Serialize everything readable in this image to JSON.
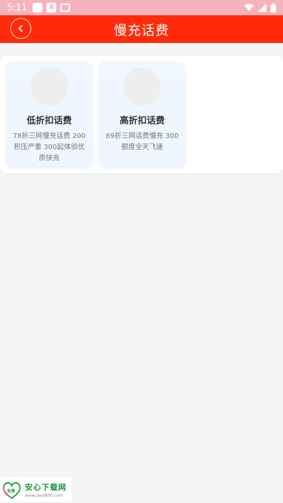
{
  "status_bar": {
    "time": "5:11",
    "icons": [
      "notification-box-icon",
      "font-a-icon",
      "image-icon",
      "wifi-icon",
      "signal-icon",
      "battery-icon"
    ]
  },
  "header": {
    "title": "慢充话费",
    "back_icon": "chevron-left-icon",
    "background_color": "#ff2b0a"
  },
  "products": [
    {
      "name": "低折扣话费",
      "description": "78折三网慢充话费 200积压严重 300起体验优质快充"
    },
    {
      "name": "高折扣话费",
      "description": "69折三网话费慢充 300额度全天飞速"
    }
  ],
  "watermark": {
    "name": "安心下载网",
    "url": "www.java800.com",
    "logo_text": "免费"
  }
}
